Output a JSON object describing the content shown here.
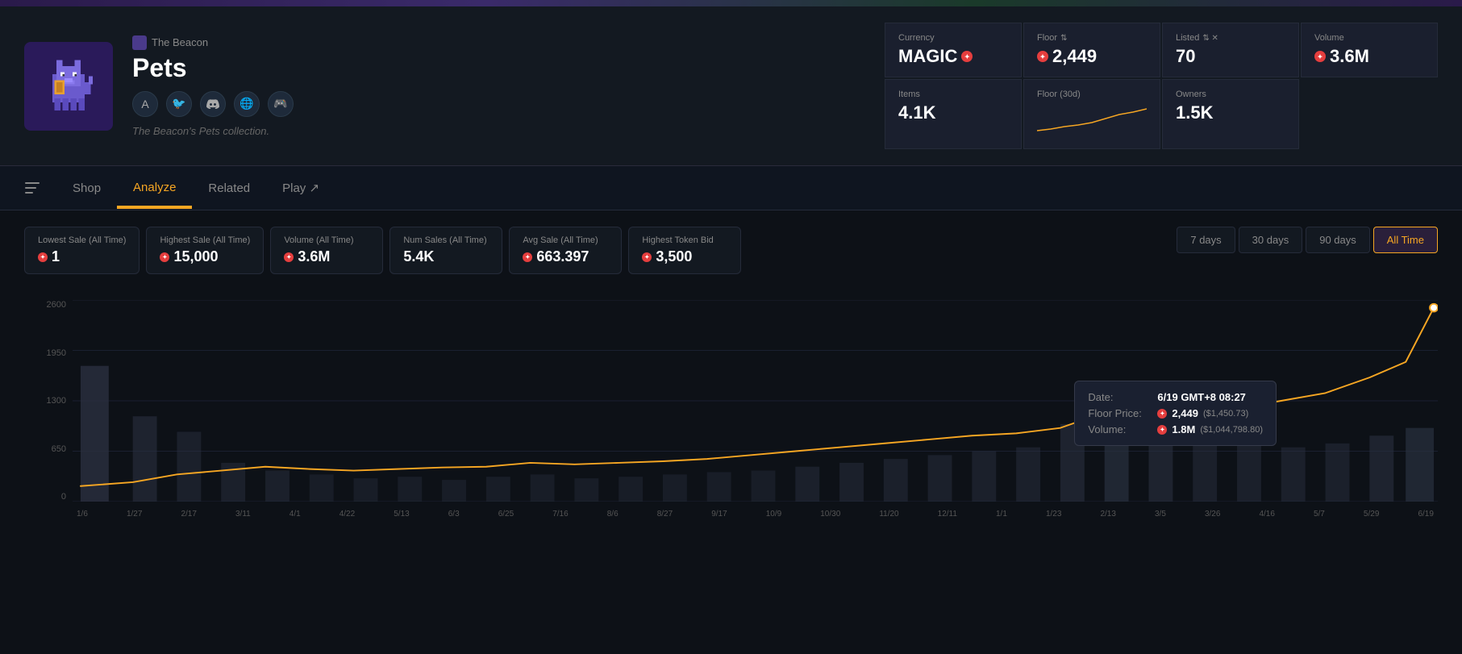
{
  "banner": {
    "bg": "#2a1a4a"
  },
  "collection": {
    "source": "The Beacon",
    "title": "Pets",
    "description": "The Beacon's Pets collection.",
    "social": [
      "A",
      "🐦",
      "💬",
      "🌐",
      "🎮"
    ]
  },
  "stats": {
    "currency_label": "Currency",
    "currency_value": "MAGIC",
    "floor_label": "Floor",
    "floor_value": "2,449",
    "listed_label": "Listed",
    "listed_value": "70",
    "volume_label": "Volume",
    "volume_value": "3.6M",
    "items_label": "Items",
    "items_value": "4.1K",
    "floor30d_label": "Floor (30d)",
    "owners_label": "Owners",
    "owners_value": "1.5K"
  },
  "nav": {
    "tabs": [
      "Shop",
      "Analyze",
      "Related",
      "Play ↗"
    ],
    "active": "Analyze"
  },
  "analytics": {
    "stats": [
      {
        "label": "Lowest Sale (All Time)",
        "value": "1"
      },
      {
        "label": "Highest Sale (All Time)",
        "value": "15,000"
      },
      {
        "label": "Volume (All Time)",
        "value": "3.6M"
      },
      {
        "label": "Num Sales (All Time)",
        "value": "5.4K"
      },
      {
        "label": "Avg Sale (All Time)",
        "value": "663.397"
      },
      {
        "label": "Highest Token Bid",
        "value": "3,500"
      }
    ],
    "time_ranges": [
      "7 days",
      "30 days",
      "90 days",
      "All Time"
    ],
    "active_range": "All Time"
  },
  "chart": {
    "y_labels": [
      "2600",
      "1950",
      "1300",
      "650",
      "0"
    ],
    "x_labels": [
      "1/6",
      "1/27",
      "2/17",
      "3/11",
      "4/1",
      "4/22",
      "5/13",
      "6/3",
      "6/25",
      "7/16",
      "8/6",
      "8/27",
      "9/17",
      "10/9",
      "10/30",
      "11/20",
      "12/11",
      "1/1",
      "1/23",
      "2/13",
      "3/5",
      "3/26",
      "4/16",
      "5/7",
      "5/29",
      "6/19"
    ]
  },
  "tooltip": {
    "date_label": "Date:",
    "date_value": "6/19 GMT+8 08:27",
    "floor_label": "Floor Price:",
    "floor_value": "2,449",
    "floor_usd": "($1,450.73)",
    "volume_label": "Volume:",
    "volume_value": "1.8M",
    "volume_usd": "($1,044,798.80)"
  },
  "colors": {
    "accent": "#f6a623",
    "magic_dot": "#e53e3e",
    "background": "#0d1117",
    "card_bg": "#131921",
    "border": "#252b3a"
  }
}
